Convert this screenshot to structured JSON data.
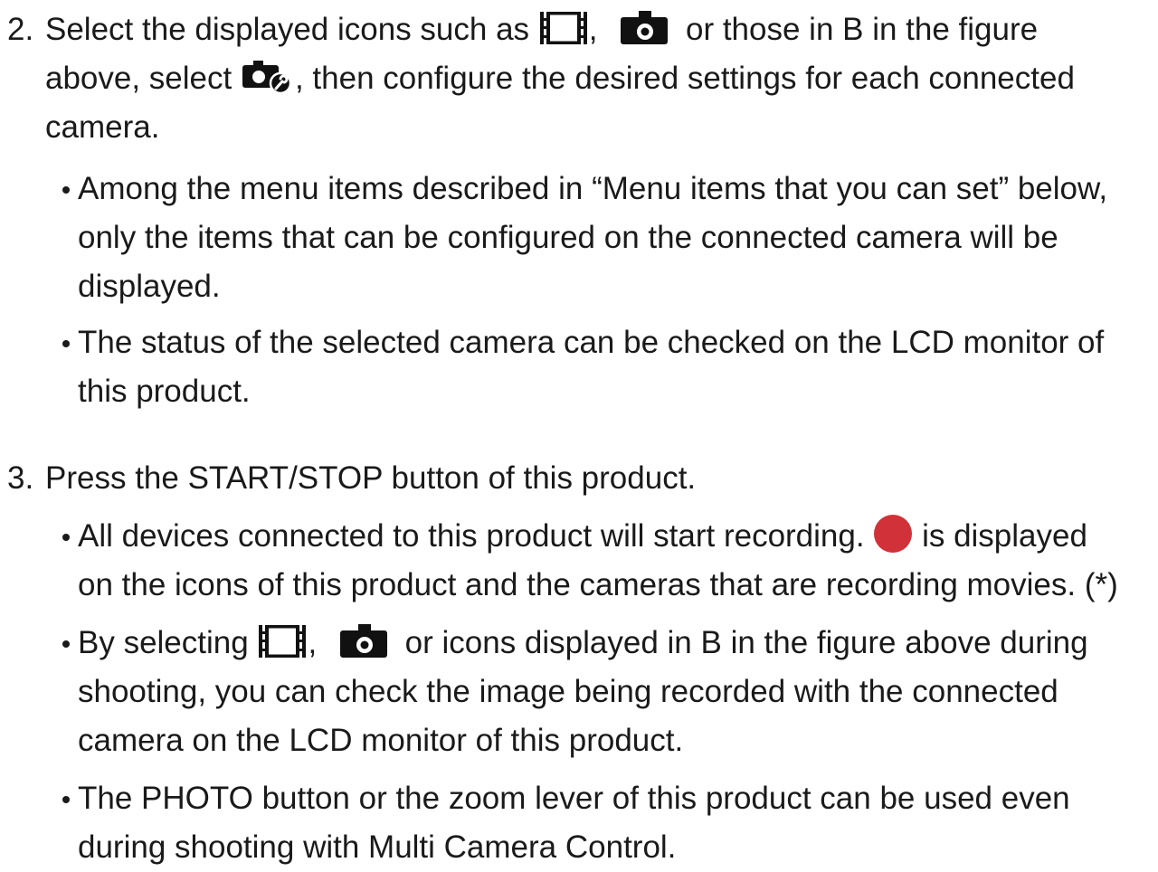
{
  "step2": {
    "number": "2.",
    "text_a": "Select the displayed icons such as",
    "sep1": ",",
    "text_b": "or those in B in the figure",
    "line2_a": "above, select",
    "line2_b": ", then configure the desired settings for each connected",
    "line3": "camera.",
    "bullets": {
      "b1_l1": "Among the menu items described in “Menu items that you can set” below,",
      "b1_l2": "only the items that can be configured on the connected camera will be",
      "b1_l3": "displayed.",
      "b2_l1": "The status of the selected camera can be checked on the LCD monitor of",
      "b2_l2": "this product."
    }
  },
  "step3": {
    "number": "3.",
    "text": "Press the START/STOP button of this product.",
    "bullets": {
      "b1_l1a": "All devices connected to this product will start recording.",
      "b1_l1b": "is displayed",
      "b1_l2": "on the icons of this product and the cameras that are recording movies. (*)",
      "b2_l1a": "By selecting",
      "b2_sep": ",",
      "b2_l1b": "or icons displayed in B in the figure above during",
      "b2_l2": "shooting, you can check the image being recorded with the connected",
      "b2_l3": "camera on the LCD monitor of this product.",
      "b3_l1": "The PHOTO button or the zoom lever of this product can be used even",
      "b3_l2": "during shooting with Multi Camera Control."
    }
  },
  "icons": {
    "movie": "movie-film-icon",
    "camera": "camera-icon",
    "camera_settings": "camera-settings-icon",
    "record": "record-dot-icon"
  },
  "colors": {
    "text": "#1a1a1a",
    "record_red": "#d1323a",
    "icon_black": "#111111"
  }
}
